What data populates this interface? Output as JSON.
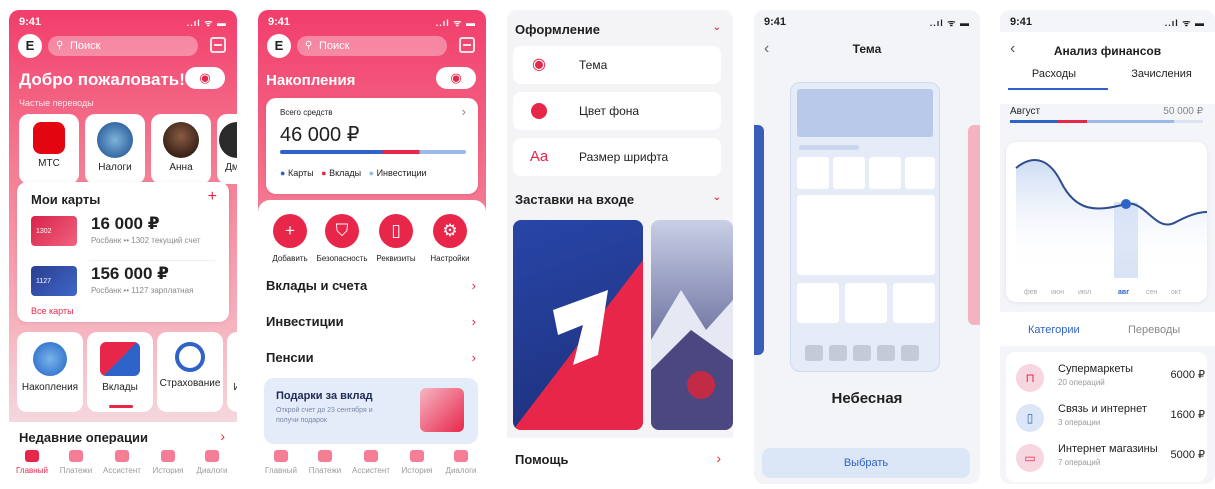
{
  "status": {
    "time": "9:41",
    "signal": "..ıl ᯤ ▬"
  },
  "s1": {
    "avatar": "E",
    "search_placeholder": "Поиск",
    "welcome": "Добро пожаловать!",
    "frequent": "Частые переводы",
    "quick": [
      "МТС",
      "Налоги",
      "Анна",
      "Дмит"
    ],
    "my_cards": "Мои карты",
    "add": "+",
    "cards": [
      {
        "num": "1302",
        "amount": "16 000 ₽",
        "sub": "Росбанк •• 1302  текущий счет"
      },
      {
        "num": "1127",
        "amount": "156 000 ₽",
        "sub": "Росбанк •• 1127  зарплатная"
      }
    ],
    "all_cards": "Все карты",
    "products": [
      "Накопления",
      "Вклады",
      "Страхование",
      "И"
    ],
    "recent": "Недавние операции"
  },
  "nav": [
    "Главный",
    "Платежи",
    "Ассистент",
    "История",
    "Диалоги"
  ],
  "s2": {
    "avatar": "E",
    "search_placeholder": "Поиск",
    "title": "Накопления",
    "total_label": "Всего средств",
    "total": "46 000 ₽",
    "legend": [
      "Карты",
      "Вклады",
      "Инвестиции"
    ],
    "actions": [
      "Добавить",
      "Безопасность",
      "Реквизиты",
      "Настройки"
    ],
    "rows": [
      "Вклады и счета",
      "Инвестиции",
      "Пенсии"
    ],
    "promo_title": "Подарки за вклад",
    "promo_text": "Открой счет до 23 сентября и получи подарок"
  },
  "s3": {
    "section1": "Оформление",
    "options": [
      "Тема",
      "Цвет фона",
      "Размер шрифта"
    ],
    "font_icon": "Aa",
    "section2": "Заставки на входе",
    "help": "Помощь"
  },
  "s4": {
    "title": "Тема",
    "theme": "Небесная",
    "button": "Выбрать"
  },
  "s5": {
    "title": "Анализ финансов",
    "tabs": [
      "Расходы",
      "Зачисления"
    ],
    "month": "Август",
    "month_amount": "50 000 ₽",
    "months": [
      "фев",
      "июн",
      "июл",
      "авг",
      "сен",
      "окт"
    ],
    "subtabs": [
      "Категории",
      "Переводы"
    ],
    "categories": [
      {
        "name": "Супермаркеты",
        "count": "20 операций",
        "amount": "6000 ₽"
      },
      {
        "name": "Связь и интернет",
        "count": "3 операции",
        "amount": "1600 ₽"
      },
      {
        "name": "Интернет магазины",
        "count": "7 операций",
        "amount": "5000 ₽"
      }
    ]
  },
  "colors": {
    "accent": "#e8264a",
    "blue": "#2e63c9"
  }
}
